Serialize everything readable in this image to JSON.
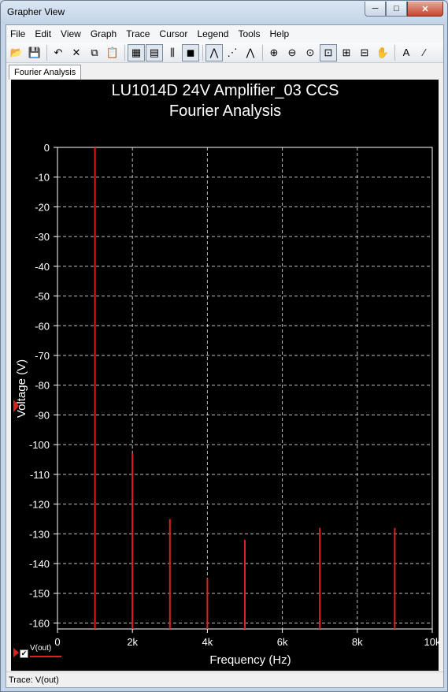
{
  "window": {
    "title": "Grapher View",
    "min_glyph": "─",
    "max_glyph": "□",
    "close_glyph": "✕"
  },
  "menu": [
    "File",
    "Edit",
    "View",
    "Graph",
    "Trace",
    "Cursor",
    "Legend",
    "Tools",
    "Help"
  ],
  "toolbar": {
    "buttons": [
      {
        "name": "open-icon",
        "glyph": "📂"
      },
      {
        "name": "save-icon",
        "glyph": "💾"
      },
      {
        "name": "undo-icon",
        "glyph": "↶"
      },
      {
        "name": "cut-icon",
        "glyph": "✕"
      },
      {
        "name": "copy-icon",
        "glyph": "⧉"
      },
      {
        "name": "paste-icon",
        "glyph": "📋"
      },
      {
        "name": "grid-icon",
        "glyph": "▦"
      },
      {
        "name": "legend-icon",
        "glyph": "▤"
      },
      {
        "name": "cursors-icon",
        "glyph": "⫼"
      },
      {
        "name": "reverse-colors-icon",
        "glyph": "◼"
      },
      {
        "name": "line-trace-icon",
        "glyph": "⋀"
      },
      {
        "name": "scatter-trace-icon",
        "glyph": "⋰"
      },
      {
        "name": "line-scatter-trace-icon",
        "glyph": "⋀"
      },
      {
        "name": "zoom-in-icon",
        "glyph": "⊕"
      },
      {
        "name": "zoom-out-icon",
        "glyph": "⊖"
      },
      {
        "name": "zoom-fit-icon",
        "glyph": "⊙"
      },
      {
        "name": "zoom-area-icon",
        "glyph": "⊡"
      },
      {
        "name": "zoom-x-icon",
        "glyph": "⊞"
      },
      {
        "name": "zoom-y-icon",
        "glyph": "⊟"
      },
      {
        "name": "pan-icon",
        "glyph": "✋"
      },
      {
        "name": "text-icon",
        "glyph": "A"
      },
      {
        "name": "label-icon",
        "glyph": "⁄"
      }
    ]
  },
  "tab": {
    "label": "Fourier Analysis"
  },
  "status": {
    "text": "Trace: V(out)"
  },
  "legend": {
    "label": "V(out)",
    "check": "✔"
  },
  "colors": {
    "plot_bg": "#000000",
    "trace": "#e02020",
    "grid": "#ffffff",
    "text": "#ffffff"
  },
  "chart_data": {
    "type": "bar",
    "title": "LU1014D 24V Amplifier_03 CCS",
    "subtitle": "Fourier Analysis",
    "xlabel": "Frequency (Hz)",
    "ylabel": "Voltage (V)",
    "xlim": [
      0,
      10000
    ],
    "ylim": [
      -162,
      0
    ],
    "x_ticks": [
      0,
      2000,
      4000,
      6000,
      8000,
      10000
    ],
    "x_tick_labels": [
      "0",
      "2k",
      "4k",
      "6k",
      "8k",
      "10k"
    ],
    "y_ticks": [
      0,
      -10,
      -20,
      -30,
      -40,
      -50,
      -60,
      -70,
      -80,
      -90,
      -100,
      -110,
      -120,
      -130,
      -140,
      -150,
      -160
    ],
    "y_tick_labels": [
      "0",
      "-10",
      "-20",
      "-30",
      "-40",
      "-50",
      "-60",
      "-70",
      "-80",
      "-90",
      "-100",
      "-110",
      "-120",
      "-130",
      "-140",
      "-150",
      "-160"
    ],
    "grid": true,
    "legend_position": "bottom-left",
    "series": [
      {
        "name": "V(out)",
        "x": [
          1000,
          2000,
          3000,
          4000,
          5000,
          6000,
          7000,
          8000,
          9000
        ],
        "y": [
          0,
          -103,
          -125,
          -145,
          -132,
          -162,
          -128,
          -162,
          -128
        ]
      }
    ]
  }
}
